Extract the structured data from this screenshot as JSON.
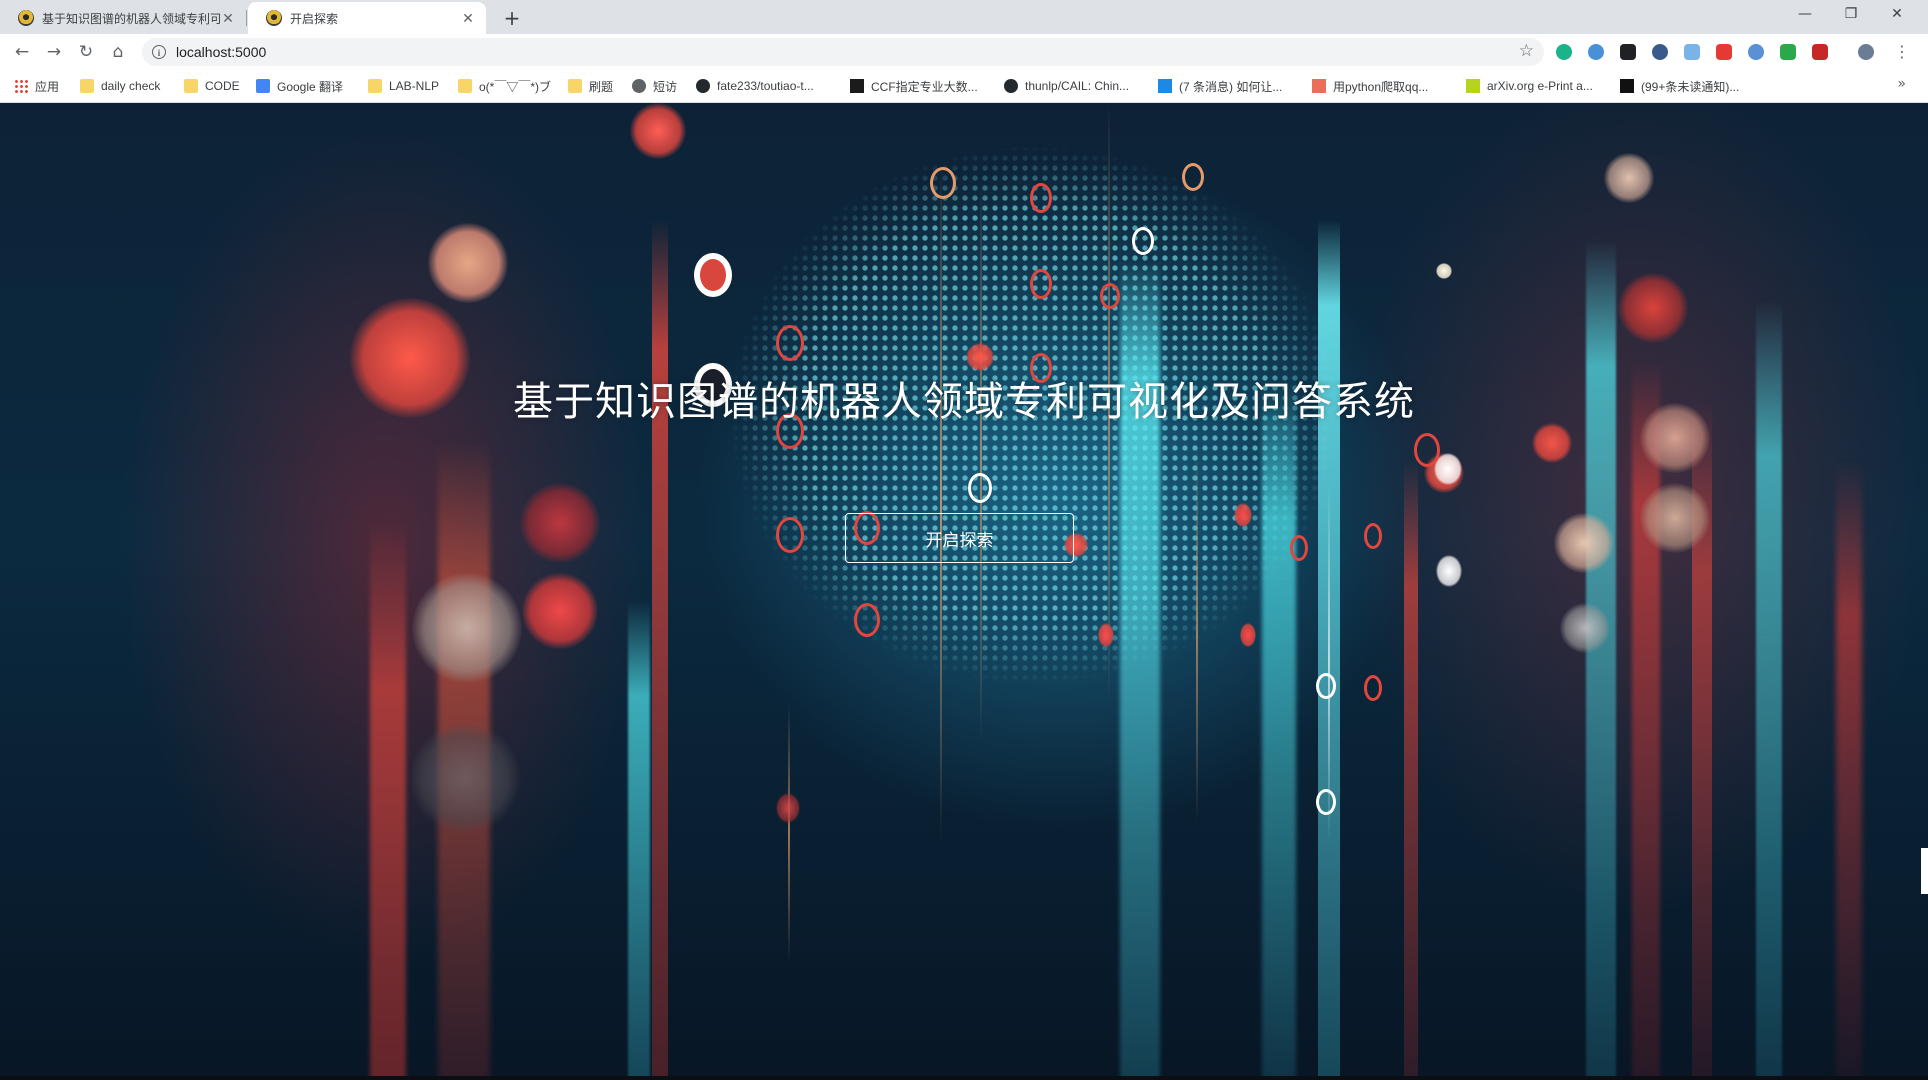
{
  "browser": {
    "tabs": [
      {
        "title": "基于知识图谱的机器人领域专利可",
        "favicon": "cosmos-badge-icon",
        "active": false
      },
      {
        "title": "开启探索",
        "favicon": "cosmos-badge-icon",
        "active": true
      }
    ],
    "url": "localhost:5000",
    "bookmarks": [
      {
        "label": "应用",
        "icon": "apps-grid-icon"
      },
      {
        "label": "daily check",
        "icon": "folder-icon"
      },
      {
        "label": "CODE",
        "icon": "folder-icon"
      },
      {
        "label": "Google 翻译",
        "icon": "google-translate-icon"
      },
      {
        "label": "LAB-NLP",
        "icon": "folder-icon"
      },
      {
        "label": "o(*￣▽￣*)ブ",
        "icon": "folder-icon"
      },
      {
        "label": "刷题",
        "icon": "folder-icon"
      },
      {
        "label": "短访",
        "icon": "globe-icon"
      },
      {
        "label": "fate233/toutiao-t...",
        "icon": "github-icon"
      },
      {
        "label": "CCF指定专业大数...",
        "icon": "df-icon"
      },
      {
        "label": "thunlp/CAIL: Chin...",
        "icon": "github-icon"
      },
      {
        "label": "(7 条消息) 如何让...",
        "icon": "zhihu-icon"
      },
      {
        "label": "用python爬取qq...",
        "icon": "jianshu-icon"
      },
      {
        "label": "arXiv.org e-Print a...",
        "icon": "arxiv-icon"
      },
      {
        "label": "(99+条未读通知)...",
        "icon": "dark-site-icon"
      }
    ],
    "bookmarks_overflow": "»"
  },
  "hero": {
    "title": "基于知识图谱的机器人领域专利可视化及问答系统",
    "button_label": "开启探索"
  },
  "colors": {
    "background": "#0b2a40",
    "cyan_accent": "#4ee0e8",
    "red_accent": "#e8433f",
    "button_border": "#ffffff"
  }
}
